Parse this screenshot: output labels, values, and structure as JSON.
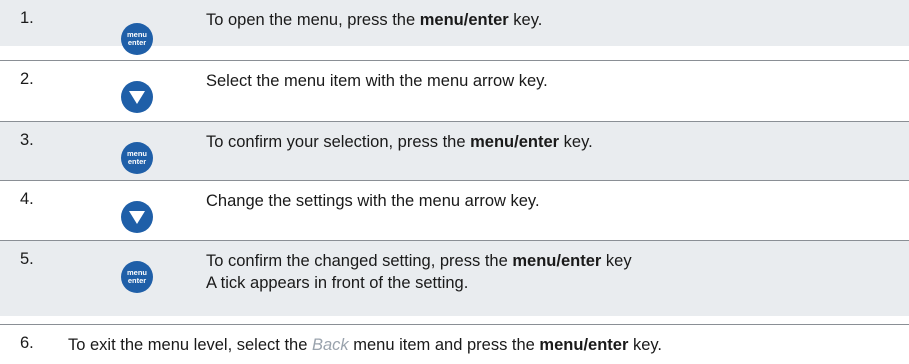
{
  "colors": {
    "accent": "#1f5fa8",
    "row_shade": "#e9ecef",
    "muted_italic": "#9aa3ad"
  },
  "icons": {
    "menu_key_line1": "menu",
    "menu_key_line2": "enter",
    "arrow_key": "down-arrow-icon"
  },
  "steps": [
    {
      "number": "1.",
      "icon": "menu-enter-key-icon",
      "pre": "To open the menu, press the ",
      "key": "menu",
      "slash": "/",
      "key2": "enter",
      "post": " key."
    },
    {
      "number": "2.",
      "icon": "down-arrow-key-icon",
      "text": "Select the menu item with the menu arrow key."
    },
    {
      "number": "3.",
      "icon": "menu-enter-key-icon",
      "pre": "To confirm your selection, press the ",
      "key": "menu",
      "slash": "/",
      "key2": "enter",
      "post": " key."
    },
    {
      "number": "4.",
      "icon": "down-arrow-key-icon",
      "text": "Change the settings with the menu arrow key."
    },
    {
      "number": "5.",
      "icon": "menu-enter-key-icon",
      "pre": "To confirm the changed setting, press the ",
      "key": "menu",
      "slash": "/",
      "key2": "enter",
      "post": " key",
      "line2": "A tick appears in front of the setting."
    },
    {
      "number": "6.",
      "pre": "To exit the menu level, select the ",
      "italic": "Back",
      "mid": " menu item and press the ",
      "key": "menu",
      "slash": "/",
      "key2": "enter",
      "post": " key."
    }
  ]
}
